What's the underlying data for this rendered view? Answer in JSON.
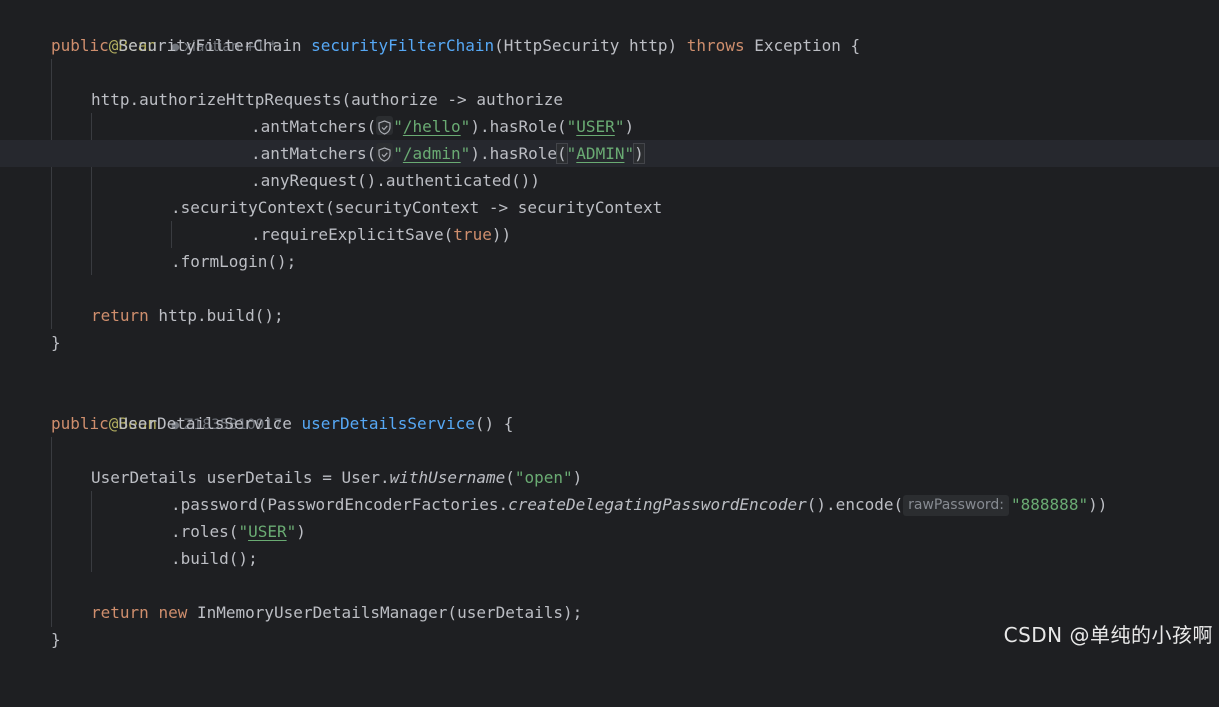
{
  "editor": {
    "bean1": {
      "annotation": "@Bean",
      "author": "xiaotian +1 *",
      "sig_kw": "public",
      "sig_type": " SecurityFilterChain ",
      "sig_fn": "securityFilterChain",
      "sig_params": "(HttpSecurity http) ",
      "sig_throws": "throws",
      "sig_rest": " Exception {"
    },
    "l3": "http.authorizeHttpRequests(authorize -> authorize",
    "l4": {
      "pre": ".antMatchers(",
      "q1": "\"",
      "path": "/hello",
      "q2": "\"",
      "mid": ").hasRole(",
      "q3": "\"",
      "role": "USER",
      "q4": "\"",
      "post": ")"
    },
    "l5": {
      "pre": ".antMatchers(",
      "q1": "\"",
      "path": "/admin",
      "q2": "\"",
      "mid": ").hasRole",
      "paren_open": "(",
      "q3": "\"",
      "role": "ADMIN",
      "q4": "\"",
      "paren_close": ")"
    },
    "l6": ".anyRequest().authenticated())",
    "l7": ".securityContext(securityContext -> securityContext",
    "l8": {
      "pre": ".requireExplicitSave(",
      "kw": "true",
      "post": "))"
    },
    "l9": ".formLogin();",
    "l11": {
      "kw": "return",
      "rest": " http.build();"
    },
    "l12": "}",
    "bean2": {
      "annotation": "@Bean",
      "author": "Z1835810917",
      "sig_kw": "public",
      "sig_type": " UserDetailsService ",
      "sig_fn": "userDetailsService",
      "sig_rest": "() {"
    },
    "l17": {
      "pre": "UserDetails userDetails = User.",
      "it": "withUsername",
      "paren": "(",
      "str": "\"open\"",
      "post": ")"
    },
    "l18": {
      "pre": ".password(PasswordEncoderFactories.",
      "it": "createDelegatingPasswordEncoder",
      "mid": "().encode(",
      "hint": "rawPassword:",
      "str": "\"888888\"",
      "post": "))"
    },
    "l19": {
      "pre": ".roles(",
      "q1": "\"",
      "role": "USER",
      "q2": "\"",
      "post": ")"
    },
    "l20": ".build();",
    "l22": {
      "kw1": "return",
      "kw2": "new",
      "rest": " InMemoryUserDetailsManager(userDetails);"
    },
    "l23": "}"
  },
  "watermark": "CSDN @单纯的小孩啊",
  "icons": {
    "gutter": "lightbulb-icon",
    "matcher": "shield-check-icon",
    "author": "person-icon"
  },
  "colors": {
    "background": "#1e1f22",
    "keyword": "#cf8e6d",
    "annotation": "#b3ae60",
    "method_decl": "#56a8f5",
    "string": "#6aab73",
    "text": "#bcbec4",
    "lightbulb": "#f0c419"
  }
}
